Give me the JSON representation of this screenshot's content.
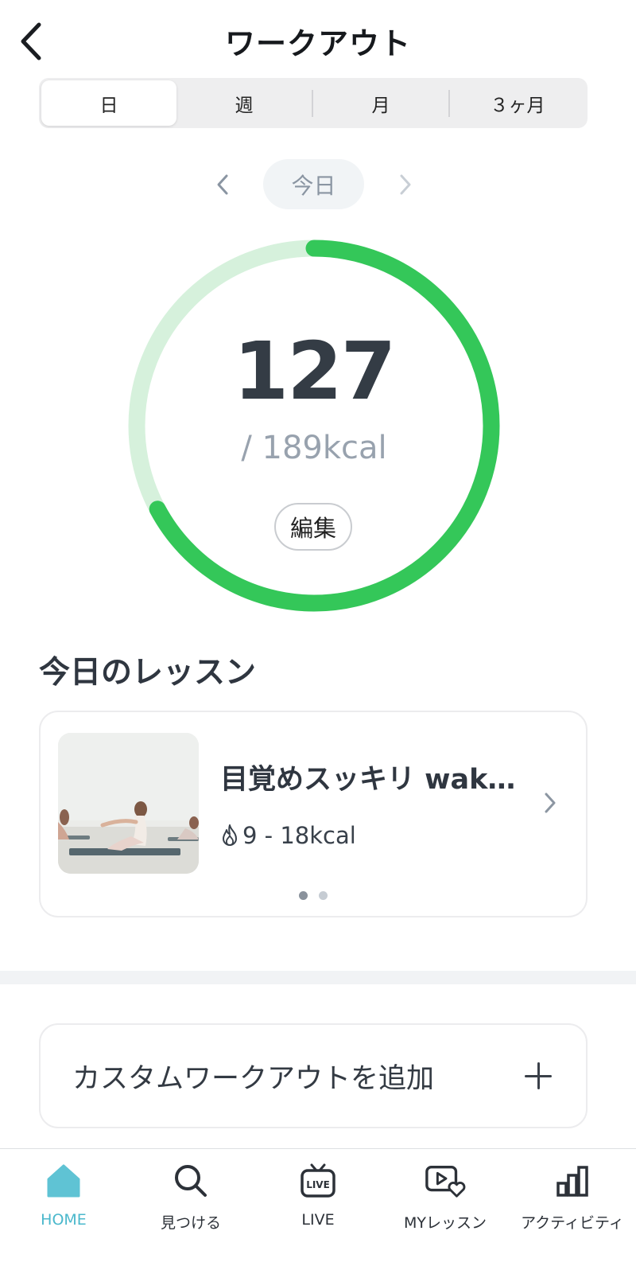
{
  "header": {
    "title": "ワークアウト",
    "back_icon": "chevron-left-icon"
  },
  "period_tabs": [
    {
      "label": "日",
      "selected": true
    },
    {
      "label": "週",
      "selected": false
    },
    {
      "label": "月",
      "selected": false
    },
    {
      "label": "３ヶ月",
      "selected": false
    }
  ],
  "date_nav": {
    "label": "今日",
    "prev_icon": "chevron-left-icon",
    "next_icon": "chevron-right-icon"
  },
  "calorie_ring": {
    "value": "127",
    "goal_text": "/ 189kcal",
    "progress": 0.672,
    "edit_label": "編集",
    "colors": {
      "progress": "#34c759",
      "track": "#d6f1dc"
    }
  },
  "lessons_section": {
    "title": "今日のレッスン",
    "lesson": {
      "title": "目覚めスッキリ wak…",
      "kcal": "9 - 18kcal",
      "kcal_icon": "flame-icon",
      "chevron_icon": "chevron-right-icon"
    },
    "pager": {
      "count": 2,
      "active": 0
    }
  },
  "custom_workout": {
    "label": "カスタムワークアウトを追加",
    "icon": "plus-icon"
  },
  "bottom_nav": [
    {
      "label": "HOME",
      "icon": "home-icon",
      "active": true
    },
    {
      "label": "見つける",
      "icon": "search-icon",
      "active": false
    },
    {
      "label": "LIVE",
      "icon": "live-tv-icon",
      "active": false
    },
    {
      "label": "MYレッスン",
      "icon": "my-lesson-icon",
      "active": false
    },
    {
      "label": "アクティビティ",
      "icon": "activity-chart-icon",
      "active": false
    }
  ],
  "accent_color": "#4bb8cc"
}
